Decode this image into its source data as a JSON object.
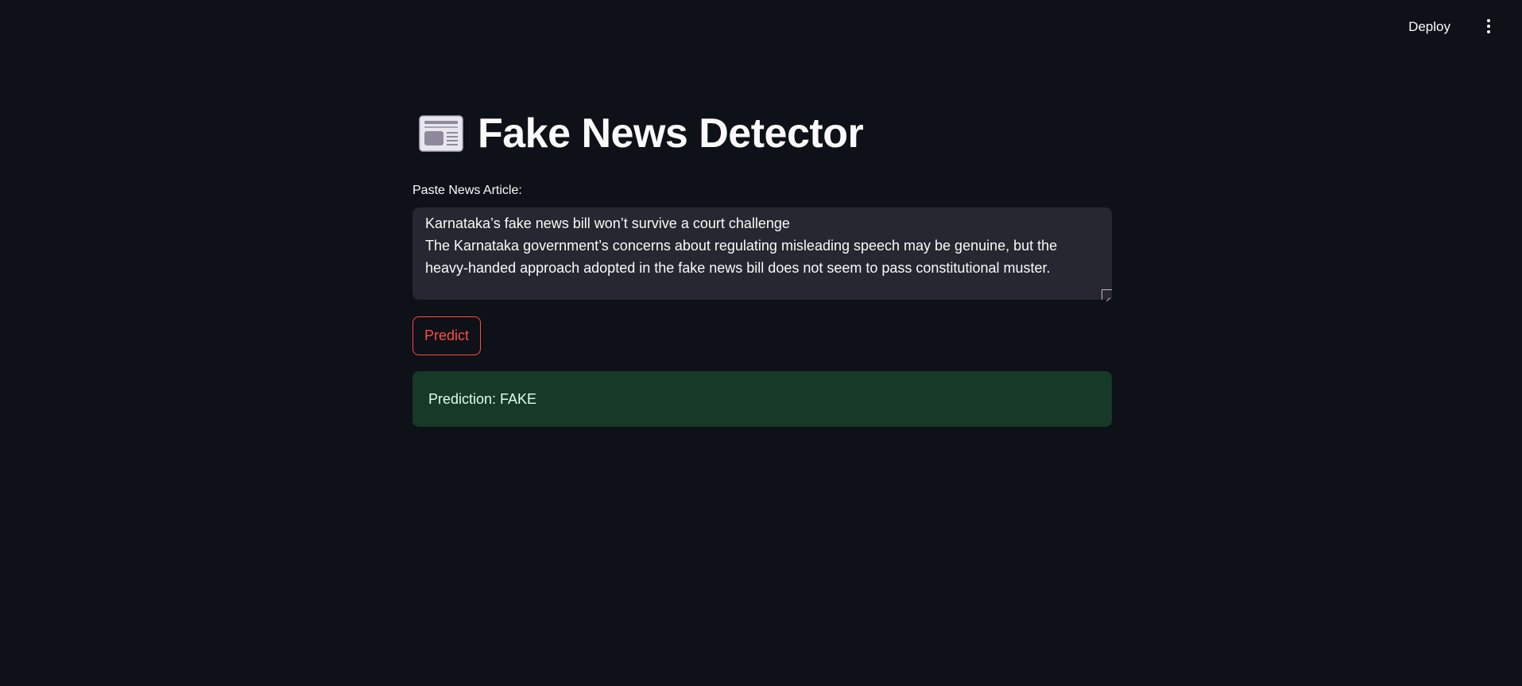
{
  "header": {
    "deploy_label": "Deploy",
    "menu_icon": "more-vertical-icon"
  },
  "main": {
    "title_icon": "newspaper-icon",
    "title": "Fake News Detector",
    "input_label": "Paste News Article:",
    "article_text": "Karnataka’s fake news bill won’t survive a court challenge\nThe Karnataka government’s concerns about regulating misleading speech may be genuine, but the heavy-handed approach adopted in the fake news bill does not seem to pass constitutional muster.",
    "predict_label": "Predict",
    "result_text": "Prediction: FAKE"
  },
  "colors": {
    "background": "#0e1117",
    "input_background": "#262730",
    "accent": "#ff4b4b",
    "success_background": "#173928",
    "success_text": "#dffde9"
  }
}
